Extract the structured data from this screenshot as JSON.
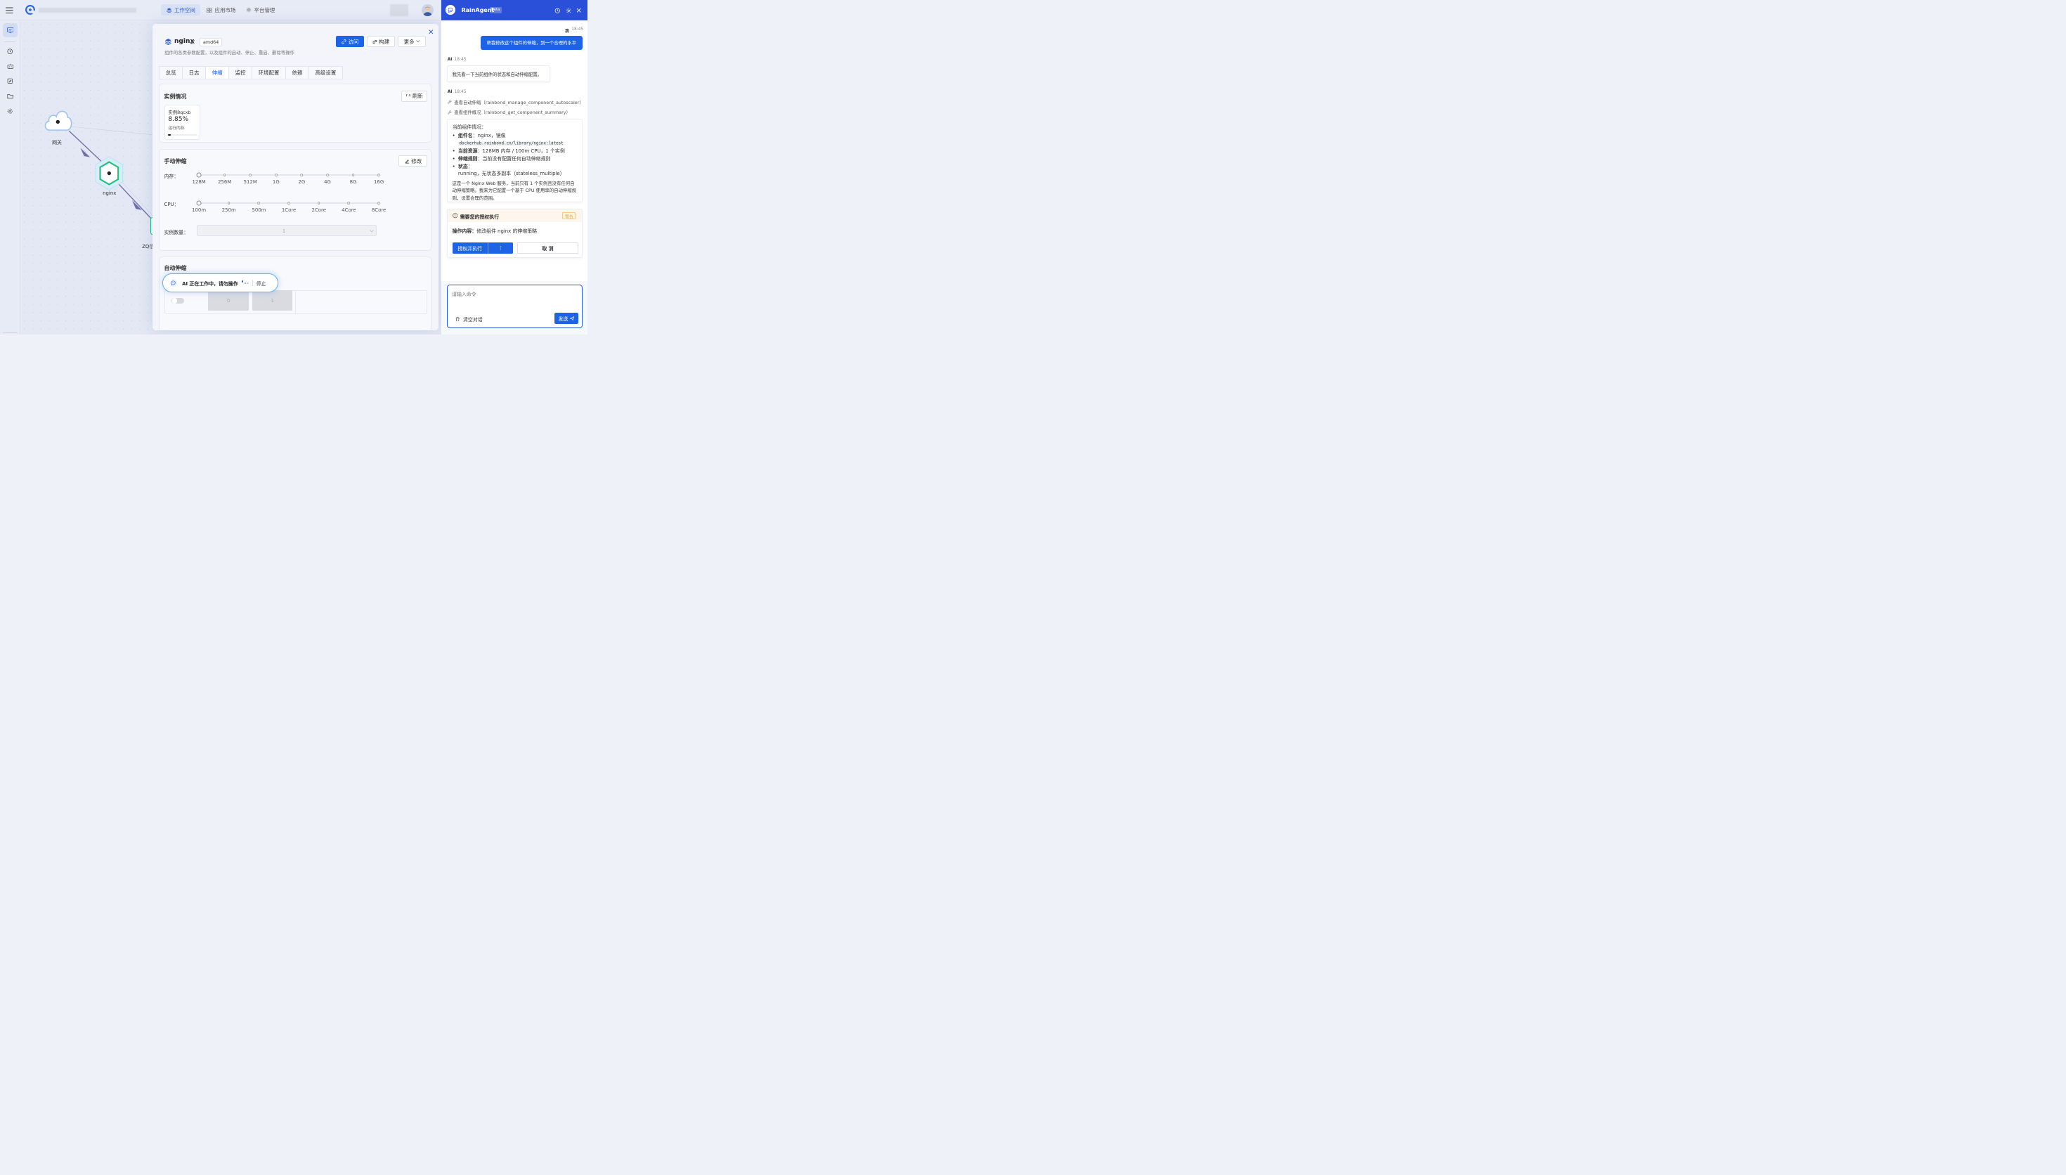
{
  "topbar": {
    "tabs": [
      {
        "label": "工作空间",
        "icon": "layers-icon",
        "active": true
      },
      {
        "label": "应用市场",
        "icon": "grid-icon",
        "active": false
      },
      {
        "label": "平台管理",
        "icon": "gear-icon",
        "active": false
      }
    ]
  },
  "topology": {
    "nodes": [
      {
        "label": "网关",
        "kind": "cloud"
      },
      {
        "label": "nginx",
        "kind": "hexagon"
      },
      {
        "label": "ZQ信",
        "kind": "service"
      }
    ]
  },
  "drawer": {
    "component_name": "nginx",
    "arch": "amd64",
    "description": "组件的各类参数配置，以及组件的启动、停止、重启、删除等操作",
    "actions": {
      "visit": "访问",
      "build": "构建",
      "more": "更多"
    },
    "tabs": [
      "总览",
      "日志",
      "伸缩",
      "监控",
      "环境配置",
      "依赖",
      "高级设置"
    ],
    "active_tab": "伸缩",
    "instances": {
      "title": "实例情况",
      "refresh": "刷新",
      "card": {
        "name": "实例8qcxb",
        "value": "8.85%",
        "label": "运行内存",
        "memory_usage": 0.0885
      }
    },
    "manual": {
      "title": "手动伸缩",
      "edit": "修改",
      "memory_label": "内存：",
      "memory_ticks": [
        "128M",
        "256M",
        "512M",
        "1G",
        "2G",
        "4G",
        "8G",
        "16G"
      ],
      "memory_selected": "128M",
      "cpu_label": "CPU：",
      "cpu_ticks": [
        "100m",
        "250m",
        "500m",
        "1Core",
        "2Core",
        "4Core",
        "8Core"
      ],
      "cpu_selected": "100m",
      "instances_label": "实例数量：",
      "instances_value": "1"
    },
    "auto": {
      "title": "自动伸缩",
      "min_value": "0",
      "max_value": "1"
    },
    "ai_overlay": {
      "text": "AI 正在工作中，请勿操作",
      "stop": "停止"
    }
  },
  "agent": {
    "title": "RainAgent",
    "badge": "Beta",
    "messages": {
      "user_name": "我",
      "user_time": "18:45",
      "user_text": "帮我修改这个组件的伸缩，到一个合理的水平",
      "ai1_name": "AI",
      "ai1_time": "18:45",
      "ai1_text": "我先看一下当前组件的状态和自动伸缩配置。",
      "ai2_name": "AI",
      "ai2_time": "18:45",
      "tool1": "查看自动伸缩（rainbond_manage_component_autoscaler）",
      "tool2": "查看组件概况（rainbond_get_component_summary）",
      "summary_title": "当前组件情况：",
      "items": [
        {
          "key": "组件名",
          "value": "nginx，镜像",
          "code": "dockerhub.rainbond.cn/library/nginx:latest"
        },
        {
          "key": "当前资源",
          "value": "128MB 内存 / 100m CPU，1 个实例"
        },
        {
          "key": "伸缩规则",
          "value": "当前没有配置任何自动伸缩规则"
        },
        {
          "key": "状态",
          "value": "running，无状态多副本（stateless_multiple）"
        }
      ],
      "summary_para": "这是一个 Nginx Web 服务，当前只有 1 个实例且没有任何自动伸缩策略。我来为它配置一个基于 CPU 使用率的自动伸缩规则，设置合理的范围。"
    },
    "auth": {
      "title": "需要您的授权执行",
      "badge": "警告",
      "content_label": "操作内容：",
      "content": "修改组件 nginx 的伸缩策略",
      "approve": "授权并执行",
      "more": "⋮",
      "cancel": "取 消"
    },
    "input": {
      "placeholder": "请输入命令",
      "clear": "清空对话",
      "send": "发送"
    }
  }
}
